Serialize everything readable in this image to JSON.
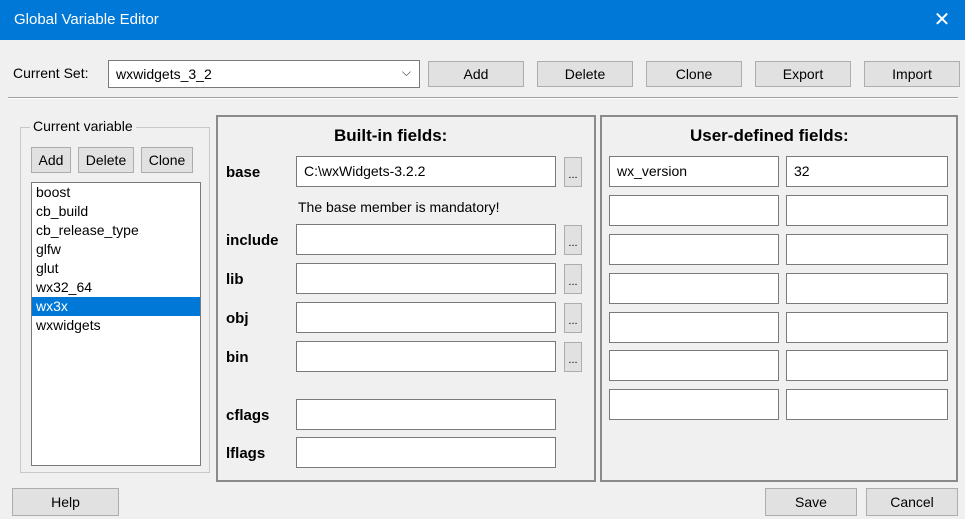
{
  "window": {
    "title": "Global Variable Editor",
    "close_glyph": "✕"
  },
  "current_set": {
    "label": "Current Set:",
    "value": "wxwidgets_3_2",
    "chevron": "⌵"
  },
  "top_buttons": {
    "add": "Add",
    "delete": "Delete",
    "clone": "Clone",
    "export": "Export",
    "import": "Import"
  },
  "current_variable": {
    "title": "Current variable",
    "add": "Add",
    "delete": "Delete",
    "clone": "Clone",
    "items": [
      "boost",
      "cb_build",
      "cb_release_type",
      "glfw",
      "glut",
      "wx32_64",
      "wx3x",
      "wxwidgets"
    ],
    "selected": "wx3x"
  },
  "builtin": {
    "title": "Built-in fields:",
    "base_label": "base",
    "base_value": "C:\\wxWidgets-3.2.2",
    "mandatory_note": "The base member is mandatory!",
    "include_label": "include",
    "lib_label": "lib",
    "obj_label": "obj",
    "bin_label": "bin",
    "cflags_label": "cflags",
    "lflags_label": "lflags",
    "browse": "..."
  },
  "userdefined": {
    "title": "User-defined fields:",
    "rows": [
      {
        "name": "wx_version",
        "value": "32"
      },
      {
        "name": "",
        "value": ""
      },
      {
        "name": "",
        "value": ""
      },
      {
        "name": "",
        "value": ""
      },
      {
        "name": "",
        "value": ""
      },
      {
        "name": "",
        "value": ""
      },
      {
        "name": "",
        "value": ""
      }
    ]
  },
  "bottom_buttons": {
    "help": "Help",
    "save": "Save",
    "cancel": "Cancel"
  }
}
